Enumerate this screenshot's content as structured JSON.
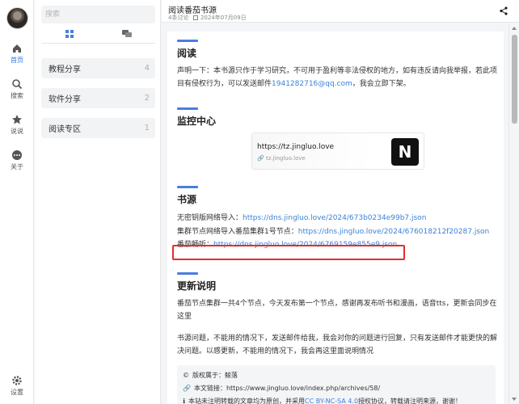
{
  "rail": {
    "items": [
      {
        "label": "首页",
        "icon": "home-icon"
      },
      {
        "label": "搜索",
        "icon": "search-icon"
      },
      {
        "label": "说说",
        "icon": "star-icon"
      },
      {
        "label": "关于",
        "icon": "more-icon"
      }
    ],
    "settings_label": "设置"
  },
  "panel": {
    "search_placeholder": "搜索",
    "categories": [
      {
        "name": "教程分享",
        "count": "4"
      },
      {
        "name": "软件分享",
        "count": "2"
      },
      {
        "name": "阅读专区",
        "count": "1"
      }
    ]
  },
  "header": {
    "title": "阅读番茄书源",
    "comments": "4条讨论",
    "date": "2024年07月09日"
  },
  "article": {
    "s1_title": "阅读",
    "s1_text_a": "声明一下：本书源只作于学习研究，不可用于盈利等非法侵权的地方，如有违反请向我举报，若此项目有侵权行为，可以发送邮件",
    "s1_email": "1941282716@qq.com",
    "s1_text_b": "，我会立即下架。",
    "s2_title": "监控中心",
    "link_url": "https://tz.jingluo.love",
    "link_domain": "tz.jingluo.love",
    "link_logo": "N",
    "s3_title": "书源",
    "line1_label": "无密钥版网络导入：",
    "line1_url": "https://dns.jingluo.love/2024/673b0234e99b7.json",
    "line2_label": "集群节点网络导入番茄集群1号节点：",
    "line2_url": "https://dns.jingluo.love/2024/676018212f20287.json",
    "line3_label": "番茄畅听：",
    "line3_url": "https://dns.jingluo.love/2024/6769159e855e9.json",
    "s4_title": "更新说明",
    "p1": "番茄节点集群一共4个节点，今天发布第一个节点，感谢再发布听书和漫画，语音tts，更新会同步在这里",
    "p2": "书源问题，不能用的情况下，发送邮件给我，我会对你的问题进行回复，只有发送邮件才能更快的解决问题。以感更新，不能用的情况下，我会再这里面说明情况",
    "info_copyright": "版权属于：鲸落",
    "info_link_label": "本文链接：",
    "info_link": "https://www.jingluo.love/index.php/archives/58/",
    "info_license_a": "本站未注明转载的文章均为原创，并采用",
    "info_license_link": "CC BY-NC-SA 4.0",
    "info_license_b": "授权协议，转载请注明来源，谢谢！"
  },
  "colors": {
    "accent": "#4a7de0",
    "link": "#3b82d6",
    "highlight_box": "#e42d2d"
  }
}
